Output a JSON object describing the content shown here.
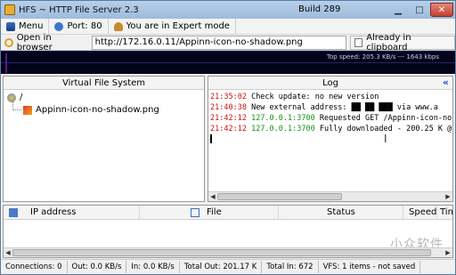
{
  "window": {
    "title": "HFS ~ HTTP File Server 2.3",
    "build": "Build 289"
  },
  "toolbar": {
    "menu": "Menu",
    "port": "Port: 80",
    "mode": "You are in Expert mode"
  },
  "urlbar": {
    "open_label": "Open in browser",
    "url": "http://172.16.0.11/Appinn-icon-no-shadow.png",
    "clipboard": "Already in clipboard"
  },
  "graph": {
    "speed": "Top speed: 205.3 KB/s  ---  1643 kbps"
  },
  "vfs": {
    "header": "Virtual File System",
    "root": "/",
    "file": "Appinn-icon-no-shadow.png"
  },
  "log": {
    "header": "Log",
    "lines": [
      {
        "time": "21:35:02",
        "ip": "",
        "text": " Check update: no new version"
      },
      {
        "time": "21:40:38",
        "ip": "",
        "text": " New external address: ██ ██ ███ via www.a"
      },
      {
        "time": "21:42:12",
        "ip": "127.0.0.1:3700",
        "text": " Requested GET /Appinn-icon-no"
      },
      {
        "time": "21:42:12",
        "ip": "127.0.0.1:3700",
        "text": " Fully downloaded - 200.25 K @"
      }
    ]
  },
  "connections": {
    "columns": {
      "ip": "IP address",
      "file": "File",
      "status": "Status",
      "speed": "Speed",
      "time": "Tin"
    },
    "watermark": "小众软件"
  },
  "status": {
    "connections": "Connections: 0",
    "out": "Out: 0.0 KB/s",
    "in": "In: 0.0 KB/s",
    "total_out": "Total Out: 201.17 K",
    "total_in": "Total In: 672",
    "vfs": "VFS: 1 items - not saved"
  },
  "colors": {
    "time": "#cc1111",
    "ip": "#149414",
    "graph_bg": "#03031a"
  }
}
